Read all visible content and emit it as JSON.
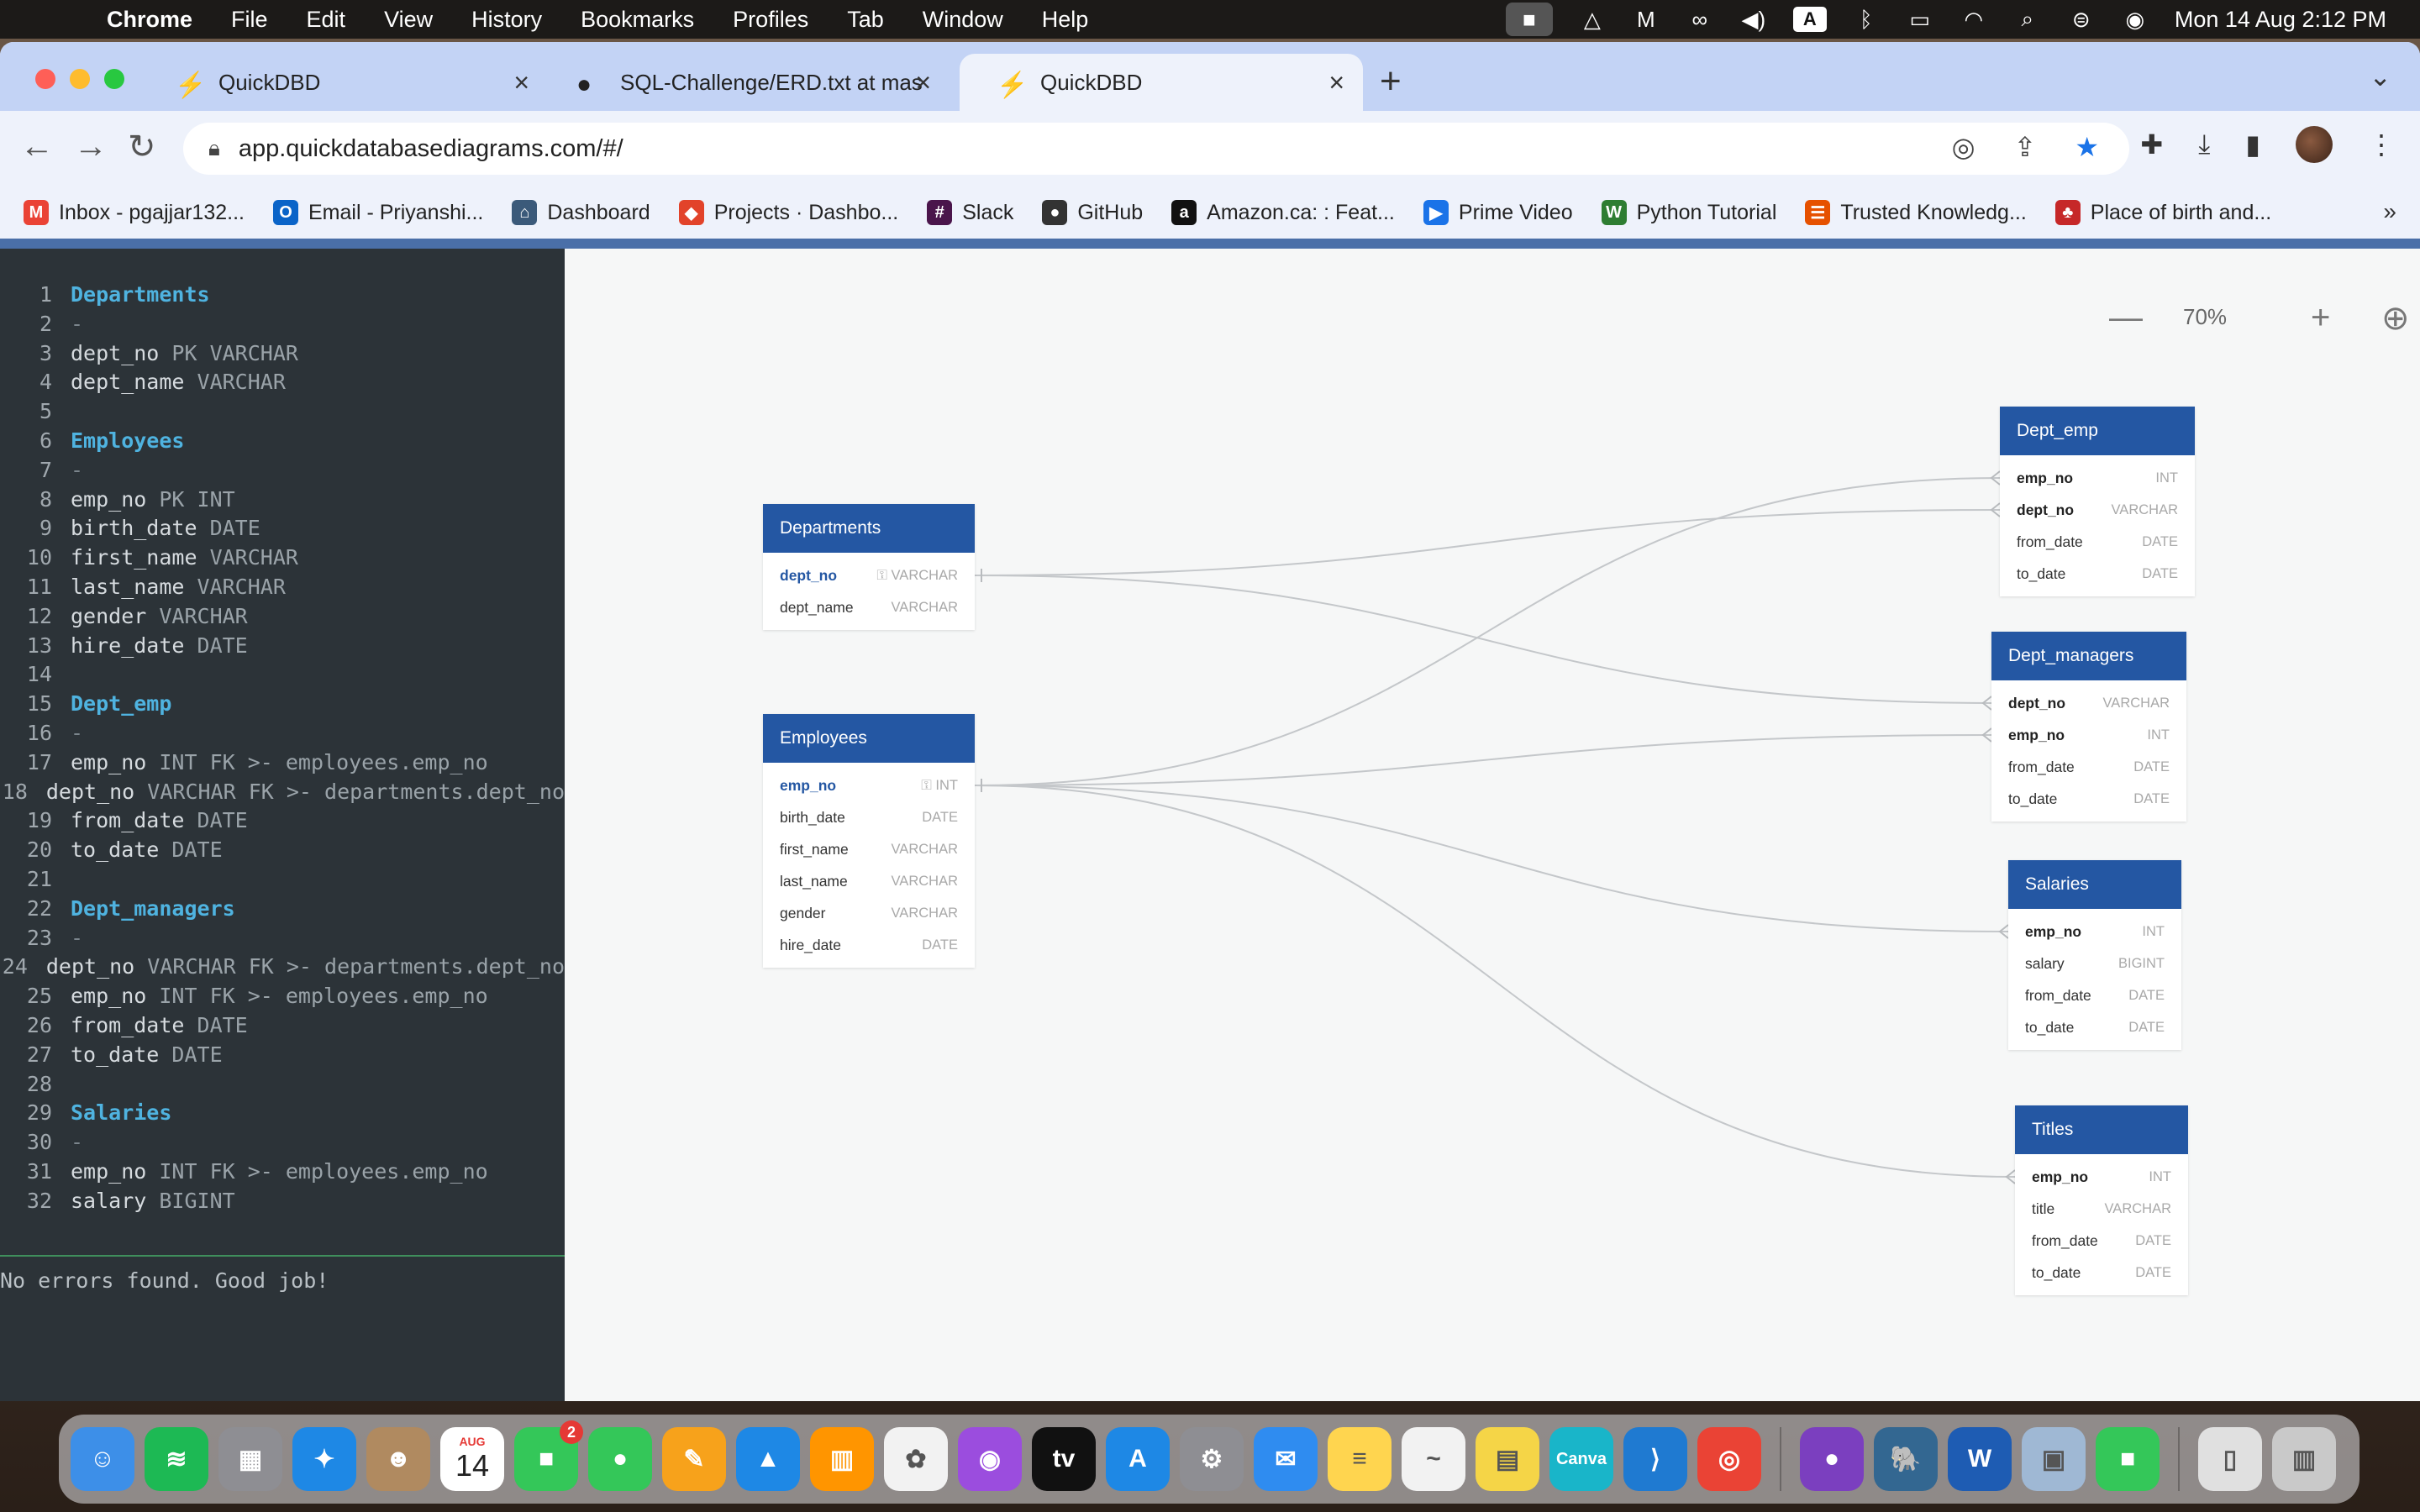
{
  "menubar": {
    "app": "Chrome",
    "items": [
      "File",
      "Edit",
      "View",
      "History",
      "Bookmarks",
      "Profiles",
      "Tab",
      "Window",
      "Help"
    ],
    "input_badge": "A",
    "clock": "Mon 14 Aug  2:12 PM"
  },
  "tabs": [
    {
      "title": "QuickDBD",
      "active": false
    },
    {
      "title": "SQL-Challenge/ERD.txt at mas",
      "active": false
    },
    {
      "title": "QuickDBD",
      "active": true
    }
  ],
  "address": {
    "url": "app.quickdatabasediagrams.com/#/"
  },
  "bookmarks": [
    {
      "label": "Inbox - pgajjar132...",
      "icon_color": "#ea4335",
      "glyph": "M"
    },
    {
      "label": "Email - Priyanshi...",
      "icon_color": "#0a64c8",
      "glyph": "O"
    },
    {
      "label": "Dashboard",
      "icon_color": "#3b5a7a",
      "glyph": "⌂"
    },
    {
      "label": "Projects · Dashbo...",
      "icon_color": "#e2432a",
      "glyph": "◆"
    },
    {
      "label": "Slack",
      "icon_color": "#4a154b",
      "glyph": "#"
    },
    {
      "label": "GitHub",
      "icon_color": "#333333",
      "glyph": "●"
    },
    {
      "label": "Amazon.ca: : Feat...",
      "icon_color": "#111111",
      "glyph": "a"
    },
    {
      "label": "Prime Video",
      "icon_color": "#1a73e8",
      "glyph": "▶"
    },
    {
      "label": "Python Tutorial",
      "icon_color": "#2e7d32",
      "glyph": "W"
    },
    {
      "label": "Trusted Knowledg...",
      "icon_color": "#e65100",
      "glyph": "☰"
    },
    {
      "label": "Place of birth and...",
      "icon_color": "#c62828",
      "glyph": "♣"
    }
  ],
  "editor": {
    "lines": [
      {
        "n": "1",
        "kind": "title",
        "parts": [
          {
            "t": "Departments",
            "c": "title"
          }
        ]
      },
      {
        "n": "2",
        "kind": "dash",
        "parts": [
          {
            "t": "-",
            "c": "dash"
          }
        ]
      },
      {
        "n": "3",
        "kind": "field",
        "parts": [
          {
            "t": "dept_no ",
            "c": "name"
          },
          {
            "t": "PK VARCHAR",
            "c": "type"
          }
        ]
      },
      {
        "n": "4",
        "kind": "field",
        "parts": [
          {
            "t": "dept_name ",
            "c": "name"
          },
          {
            "t": "VARCHAR",
            "c": "type"
          }
        ]
      },
      {
        "n": "5",
        "kind": "blank",
        "parts": []
      },
      {
        "n": "6",
        "kind": "title",
        "parts": [
          {
            "t": "Employees",
            "c": "title"
          }
        ]
      },
      {
        "n": "7",
        "kind": "dash",
        "parts": [
          {
            "t": "-",
            "c": "dash"
          }
        ]
      },
      {
        "n": "8",
        "kind": "field",
        "parts": [
          {
            "t": "emp_no ",
            "c": "name"
          },
          {
            "t": "PK INT",
            "c": "type"
          }
        ]
      },
      {
        "n": "9",
        "kind": "field",
        "parts": [
          {
            "t": "birth_date ",
            "c": "name"
          },
          {
            "t": "DATE",
            "c": "type"
          }
        ]
      },
      {
        "n": "10",
        "kind": "field",
        "parts": [
          {
            "t": "first_name ",
            "c": "name"
          },
          {
            "t": "VARCHAR",
            "c": "type"
          }
        ]
      },
      {
        "n": "11",
        "kind": "field",
        "parts": [
          {
            "t": "last_name ",
            "c": "name"
          },
          {
            "t": "VARCHAR",
            "c": "type"
          }
        ]
      },
      {
        "n": "12",
        "kind": "field",
        "parts": [
          {
            "t": "gender ",
            "c": "name"
          },
          {
            "t": "VARCHAR",
            "c": "type"
          }
        ]
      },
      {
        "n": "13",
        "kind": "field",
        "parts": [
          {
            "t": "hire_date ",
            "c": "name"
          },
          {
            "t": "DATE",
            "c": "type"
          }
        ]
      },
      {
        "n": "14",
        "kind": "blank",
        "parts": []
      },
      {
        "n": "15",
        "kind": "title",
        "parts": [
          {
            "t": "Dept_emp",
            "c": "title"
          }
        ]
      },
      {
        "n": "16",
        "kind": "dash",
        "parts": [
          {
            "t": "-",
            "c": "dash"
          }
        ]
      },
      {
        "n": "17",
        "kind": "field",
        "parts": [
          {
            "t": "emp_no ",
            "c": "name"
          },
          {
            "t": "INT FK >- employees.emp_no",
            "c": "type"
          }
        ]
      },
      {
        "n": "18",
        "kind": "field",
        "parts": [
          {
            "t": "dept_no ",
            "c": "name"
          },
          {
            "t": "VARCHAR FK >- departments.dept_no",
            "c": "type"
          }
        ]
      },
      {
        "n": "19",
        "kind": "field",
        "parts": [
          {
            "t": "from_date ",
            "c": "name"
          },
          {
            "t": "DATE",
            "c": "type"
          }
        ]
      },
      {
        "n": "20",
        "kind": "field",
        "parts": [
          {
            "t": "to_date ",
            "c": "name"
          },
          {
            "t": "DATE",
            "c": "type"
          }
        ]
      },
      {
        "n": "21",
        "kind": "blank",
        "parts": []
      },
      {
        "n": "22",
        "kind": "title",
        "parts": [
          {
            "t": "Dept_managers",
            "c": "title"
          }
        ]
      },
      {
        "n": "23",
        "kind": "dash",
        "parts": [
          {
            "t": "-",
            "c": "dash"
          }
        ]
      },
      {
        "n": "24",
        "kind": "field",
        "parts": [
          {
            "t": "dept_no ",
            "c": "name"
          },
          {
            "t": "VARCHAR FK >- departments.dept_no",
            "c": "type"
          }
        ]
      },
      {
        "n": "25",
        "kind": "field",
        "parts": [
          {
            "t": "emp_no ",
            "c": "name"
          },
          {
            "t": "INT FK >- employees.emp_no",
            "c": "type"
          }
        ]
      },
      {
        "n": "26",
        "kind": "field",
        "parts": [
          {
            "t": "from_date ",
            "c": "name"
          },
          {
            "t": "DATE",
            "c": "type"
          }
        ]
      },
      {
        "n": "27",
        "kind": "field",
        "parts": [
          {
            "t": "to_date ",
            "c": "name"
          },
          {
            "t": "DATE",
            "c": "type"
          }
        ]
      },
      {
        "n": "28",
        "kind": "blank",
        "parts": []
      },
      {
        "n": "29",
        "kind": "title",
        "parts": [
          {
            "t": "Salaries",
            "c": "title"
          }
        ]
      },
      {
        "n": "30",
        "kind": "dash",
        "parts": [
          {
            "t": "-",
            "c": "dash"
          }
        ]
      },
      {
        "n": "31",
        "kind": "field",
        "parts": [
          {
            "t": "emp_no ",
            "c": "name"
          },
          {
            "t": "INT FK >- employees.emp_no",
            "c": "type"
          }
        ]
      },
      {
        "n": "32",
        "kind": "field",
        "parts": [
          {
            "t": "salary ",
            "c": "name"
          },
          {
            "t": "BIGINT",
            "c": "type"
          }
        ]
      }
    ],
    "status": "No errors found. Good job!"
  },
  "canvas": {
    "zoom_label": "70%",
    "tables": [
      {
        "id": "departments",
        "title": "Departments",
        "fields": [
          {
            "name": "dept_no",
            "type": "VARCHAR",
            "pk": true
          },
          {
            "name": "dept_name",
            "type": "VARCHAR"
          }
        ]
      },
      {
        "id": "employees",
        "title": "Employees",
        "fields": [
          {
            "name": "emp_no",
            "type": "INT",
            "pk": true
          },
          {
            "name": "birth_date",
            "type": "DATE"
          },
          {
            "name": "first_name",
            "type": "VARCHAR"
          },
          {
            "name": "last_name",
            "type": "VARCHAR"
          },
          {
            "name": "gender",
            "type": "VARCHAR"
          },
          {
            "name": "hire_date",
            "type": "DATE"
          }
        ]
      },
      {
        "id": "dept_emp",
        "title": "Dept_emp",
        "fields": [
          {
            "name": "emp_no",
            "type": "INT",
            "bold": true
          },
          {
            "name": "dept_no",
            "type": "VARCHAR",
            "bold": true
          },
          {
            "name": "from_date",
            "type": "DATE"
          },
          {
            "name": "to_date",
            "type": "DATE"
          }
        ]
      },
      {
        "id": "dept_managers",
        "title": "Dept_managers",
        "fields": [
          {
            "name": "dept_no",
            "type": "VARCHAR",
            "bold": true
          },
          {
            "name": "emp_no",
            "type": "INT",
            "bold": true
          },
          {
            "name": "from_date",
            "type": "DATE"
          },
          {
            "name": "to_date",
            "type": "DATE"
          }
        ]
      },
      {
        "id": "salaries",
        "title": "Salaries",
        "fields": [
          {
            "name": "emp_no",
            "type": "INT",
            "bold": true
          },
          {
            "name": "salary",
            "type": "BIGINT"
          },
          {
            "name": "from_date",
            "type": "DATE"
          },
          {
            "name": "to_date",
            "type": "DATE"
          }
        ]
      },
      {
        "id": "titles",
        "title": "Titles",
        "fields": [
          {
            "name": "emp_no",
            "type": "INT",
            "bold": true
          },
          {
            "name": "title",
            "type": "VARCHAR"
          },
          {
            "name": "from_date",
            "type": "DATE"
          },
          {
            "name": "to_date",
            "type": "DATE"
          }
        ]
      }
    ],
    "relations": [
      {
        "from": "departments.dept_no",
        "to": "dept_emp.dept_no"
      },
      {
        "from": "departments.dept_no",
        "to": "dept_managers.dept_no"
      },
      {
        "from": "employees.emp_no",
        "to": "dept_emp.emp_no"
      },
      {
        "from": "employees.emp_no",
        "to": "dept_managers.emp_no"
      },
      {
        "from": "employees.emp_no",
        "to": "salaries.emp_no"
      },
      {
        "from": "employees.emp_no",
        "to": "titles.emp_no"
      }
    ]
  },
  "dock": {
    "calendar": {
      "month": "AUG",
      "day": "14"
    },
    "facetime_badge": "2",
    "apps": [
      {
        "name": "finder",
        "color": "#3d8fe8",
        "glyph": "☺"
      },
      {
        "name": "spotify",
        "color": "#1db954",
        "glyph": "≋"
      },
      {
        "name": "launchpad",
        "color": "#8e8e93",
        "glyph": "▦"
      },
      {
        "name": "safari",
        "color": "#1e88e5",
        "glyph": "✦"
      },
      {
        "name": "contacts",
        "color": "#b08a60",
        "glyph": "☻"
      },
      {
        "name": "calendar",
        "color": "#ffffff",
        "glyph": ""
      },
      {
        "name": "facetime",
        "color": "#34c759",
        "glyph": "■"
      },
      {
        "name": "messages",
        "color": "#34c759",
        "glyph": "●"
      },
      {
        "name": "pages",
        "color": "#f7a21b",
        "glyph": "✎"
      },
      {
        "name": "keynote",
        "color": "#1e88e5",
        "glyph": "▲"
      },
      {
        "name": "books",
        "color": "#ff9500",
        "glyph": "▥"
      },
      {
        "name": "photos",
        "color": "#f2f2f2",
        "glyph": "✿"
      },
      {
        "name": "podcasts",
        "color": "#9b4dde",
        "glyph": "◉"
      },
      {
        "name": "apple-tv",
        "color": "#111111",
        "glyph": "tv"
      },
      {
        "name": "app-store",
        "color": "#1e88e5",
        "glyph": "A"
      },
      {
        "name": "system-settings",
        "color": "#8e8e93",
        "glyph": "⚙"
      },
      {
        "name": "mail",
        "color": "#2f8cf0",
        "glyph": "✉"
      },
      {
        "name": "notes",
        "color": "#ffd54f",
        "glyph": "≡"
      },
      {
        "name": "freeform",
        "color": "#f2f2f2",
        "glyph": "~"
      },
      {
        "name": "stickies",
        "color": "#f5d547",
        "glyph": "▤"
      },
      {
        "name": "canva",
        "color": "#19b5c9",
        "glyph": "Canva"
      },
      {
        "name": "vscode",
        "color": "#1f7ad1",
        "glyph": "⟩"
      },
      {
        "name": "chrome",
        "color": "#ea4335",
        "glyph": "◎"
      },
      {
        "name": "github-desktop",
        "color": "#7b3fbf",
        "glyph": "●"
      },
      {
        "name": "postgres",
        "color": "#336791",
        "glyph": "🐘"
      },
      {
        "name": "word",
        "color": "#1e5cb3",
        "glyph": "W"
      },
      {
        "name": "preview",
        "color": "#9fb8d4",
        "glyph": "▣"
      },
      {
        "name": "facetime-2",
        "color": "#34c759",
        "glyph": "■"
      },
      {
        "name": "documents",
        "color": "#e0e0e0",
        "glyph": "▯"
      },
      {
        "name": "trash",
        "color": "#c9c9c9",
        "glyph": "▥"
      }
    ]
  }
}
